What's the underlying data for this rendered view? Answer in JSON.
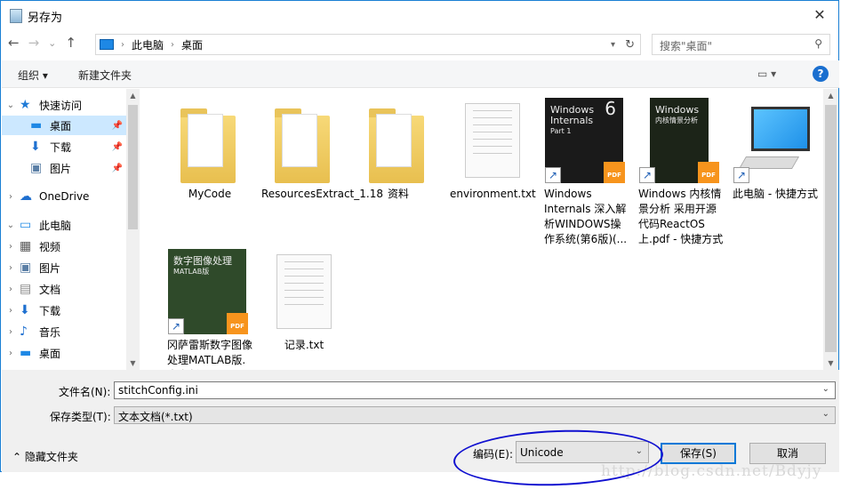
{
  "window": {
    "title": "另存为",
    "close": "✕"
  },
  "nav": {
    "back": "←",
    "forward": "→",
    "recent": "⌄",
    "up": "↑"
  },
  "address": {
    "crumbs": [
      "此电脑",
      "桌面"
    ],
    "separator": "›"
  },
  "search": {
    "placeholder": "搜索\"桌面\"",
    "icon": "search-icon"
  },
  "toolbar": {
    "organize": "组织 ▾",
    "new_folder": "新建文件夹",
    "help": "?",
    "view": "▭ ▾"
  },
  "sidebar": {
    "items": [
      {
        "label": "快速访问",
        "chev": "⌄",
        "icon": "star",
        "color": "#1e7ad6"
      },
      {
        "label": "桌面",
        "icon": "desktop",
        "color": "#1e88e5",
        "pin": true,
        "selected": true
      },
      {
        "label": "下载",
        "icon": "download",
        "color": "#1e70d0",
        "pin": true
      },
      {
        "label": "图片",
        "icon": "pictures",
        "color": "#5b7fa6",
        "pin": true
      },
      {
        "label": "OneDrive",
        "chev": "›",
        "icon": "cloud",
        "color": "#1e6fcf"
      },
      {
        "label": "此电脑",
        "chev": "⌄",
        "icon": "computer",
        "color": "#1e88e5"
      },
      {
        "label": "视频",
        "chev": "›",
        "icon": "video",
        "color": "#555"
      },
      {
        "label": "图片",
        "chev": "›",
        "icon": "pictures",
        "color": "#5b7fa6"
      },
      {
        "label": "文档",
        "chev": "›",
        "icon": "document",
        "color": "#888"
      },
      {
        "label": "下载",
        "chev": "›",
        "icon": "download",
        "color": "#1e70d0"
      },
      {
        "label": "音乐",
        "chev": "›",
        "icon": "music",
        "color": "#1e70d0"
      },
      {
        "label": "桌面",
        "chev": "›",
        "icon": "desktop",
        "color": "#1e88e5"
      }
    ]
  },
  "files": [
    {
      "name": "MyCode",
      "type": "folder"
    },
    {
      "name": "ResourcesExtract_1.18",
      "type": "folder"
    },
    {
      "name": "资料",
      "type": "folder"
    },
    {
      "name": "environment.txt",
      "type": "text"
    },
    {
      "name": "Windows Internals 深入解析WINDOWS操作系统(第6版)(...",
      "type": "pdf-shortcut",
      "cover_title": "Windows Internals",
      "cover_sub": "Part 1",
      "cover_num": "6",
      "cover_color": "#1a1a1a"
    },
    {
      "name": "Windows 内核情景分析 采用开源代码ReactOS 上.pdf - 快捷方式",
      "type": "pdf-shortcut",
      "cover_title": "Windows",
      "cover_sub": "内核情景分析",
      "cover_color": "#1c2418"
    },
    {
      "name": "此电脑 - 快捷方式",
      "type": "computer-shortcut"
    },
    {
      "name": "冈萨雷斯数字图像处理MATLAB版.中文版...df",
      "type": "pdf-shortcut",
      "cover_title": "数字图像处理",
      "cover_sub": "MATLAB版",
      "cover_color": "#2f4a2a"
    },
    {
      "name": "记录.txt",
      "type": "text"
    }
  ],
  "form": {
    "filename_label": "文件名(N):",
    "filename_value": "stitchConfig.ini",
    "type_label": "保存类型(T):",
    "type_value": "文本文档(*.txt)",
    "hide_folders": "隐藏文件夹",
    "encoding_label": "编码(E):",
    "encoding_value": "Unicode",
    "save": "保存(S)",
    "cancel": "取消"
  },
  "watermark": "http://blog.csdn.net/Bdyjy",
  "colors": {
    "accent": "#0078d7",
    "selection": "#cce8ff",
    "annotation": "#1010d0"
  }
}
